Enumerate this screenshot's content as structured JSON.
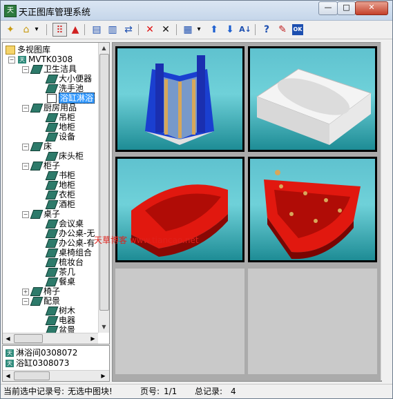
{
  "window": {
    "title": "天正图库管理系统",
    "app_icon_text": "天"
  },
  "titlebar_buttons": {
    "minimize": "—",
    "maximize": "□",
    "close": "✕"
  },
  "toolbar": {
    "icons": [
      "new-icon",
      "open-icon",
      "dropdown-icon",
      "grid-select-icon",
      "triangle-icon",
      "export-icon",
      "import-icon",
      "replace-icon",
      "delete-red-icon",
      "delete-icon",
      "view-mode-icon",
      "view-dropdown-icon",
      "move-up-icon",
      "move-down-icon",
      "sort-icon",
      "help-icon",
      "edit-icon",
      "ok-icon"
    ],
    "glyphs": {
      "new": "✦",
      "open": "⌂",
      "dropdown": "▾",
      "grid_select": "⠿",
      "triangle": "▲",
      "export": "▤",
      "import": "▥",
      "replace": "⇄",
      "delete_red": "✕",
      "delete": "✕",
      "view_mode": "▦",
      "up": "⬆",
      "down": "⬇",
      "sort": "A↓",
      "help": "?",
      "edit": "✎",
      "ok": "OK"
    }
  },
  "tree": {
    "root": "多视图库",
    "library": "MVTK0308",
    "categories": [
      {
        "label": "卫生洁具",
        "expanded": true,
        "items": [
          "大小便器",
          "洗手池",
          "浴缸淋浴间"
        ]
      },
      {
        "label": "厨房用品",
        "expanded": true,
        "items": [
          "吊柜",
          "地柜",
          "设备"
        ]
      },
      {
        "label": "床",
        "expanded": true,
        "items": [
          "床头柜"
        ]
      },
      {
        "label": "柜子",
        "expanded": true,
        "items": [
          "书柜",
          "地柜",
          "衣柜",
          "酒柜"
        ]
      },
      {
        "label": "桌子",
        "expanded": true,
        "items": [
          "会议桌",
          "办公桌-无",
          "办公桌-有",
          "桌椅组合",
          "梳妆台",
          "茶几",
          "餐桌"
        ]
      },
      {
        "label": "椅子",
        "expanded": false,
        "items": []
      },
      {
        "label": "配景",
        "expanded": true,
        "items": [
          "树木",
          "电器",
          "盆景"
        ]
      }
    ],
    "selected": "浴缸淋浴间",
    "selected_display": "浴缸淋浴"
  },
  "record_list": [
    {
      "label": "淋浴间0308072"
    },
    {
      "label": "浴缸0308073"
    }
  ],
  "thumbnails": [
    {
      "name": "shower-enclosure",
      "filled": true
    },
    {
      "name": "white-bathtub",
      "filled": true
    },
    {
      "name": "red-corner-bathtub",
      "filled": true
    },
    {
      "name": "red-jacuzzi-tub",
      "filled": true
    },
    {
      "name": "empty-slot-1",
      "filled": false
    },
    {
      "name": "empty-slot-2",
      "filled": false
    }
  ],
  "watermark": "天草博客 www.tiancao.net",
  "status": {
    "current_label": "当前选中记录号:",
    "current_value": "无选中图块!",
    "page_label": "页号:",
    "page_value": "1/1",
    "total_label": "总记录:",
    "total_value": "4"
  },
  "colors": {
    "accent_select": "#3399ff",
    "thumb_bg": "#6fd1d9",
    "red_tub": "#e1180f",
    "blue_shower": "#1a3fd0"
  }
}
